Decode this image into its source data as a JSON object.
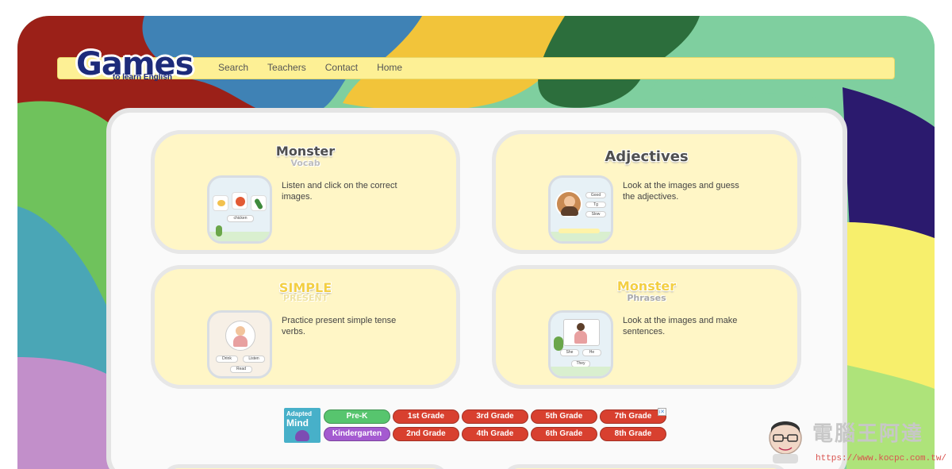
{
  "logo": {
    "main": "Games",
    "sub": "to learn English"
  },
  "nav": {
    "items": [
      "Search",
      "Teachers",
      "Contact",
      "Home"
    ]
  },
  "cards": [
    {
      "title": "Monster",
      "subtitle": "Vocab",
      "description": "Listen and click on the correct images.",
      "thumb_label": "chicken"
    },
    {
      "title": "Adjectives",
      "subtitle": "",
      "description": "Look at the images and guess the adjectives.",
      "thumb_options": [
        "Good",
        "Tg",
        "Slow"
      ]
    },
    {
      "title": "SIMPLE",
      "subtitle": "PRESENT",
      "description": "Practice present simple tense verbs.",
      "thumb_options": [
        "Drink",
        "Listen",
        "Read"
      ]
    },
    {
      "title": "Monster",
      "subtitle": "Phrases",
      "description": "Look at the images and make sentences.",
      "thumb_options": [
        "She",
        "He",
        "They"
      ]
    }
  ],
  "ad": {
    "brand_line1": "Adapted",
    "brand_line2": "Mind",
    "grades_row1": [
      "Pre-K",
      "1st Grade",
      "3rd Grade",
      "5th Grade",
      "7th Grade"
    ],
    "grades_row2": [
      "Kindergarten",
      "2nd Grade",
      "4th Grade",
      "6th Grade",
      "8th Grade"
    ],
    "corner_mark": "i✕",
    "colors": {
      "prek": "#57c56e",
      "kinder": "#a45ad0",
      "grade": "#d8402f"
    }
  },
  "watermark": {
    "title": "電腦王阿達",
    "url": "https://www.kocpc.com.tw/"
  },
  "colors": {
    "navbar": "#fdf095",
    "card": "#fff6c6",
    "panel": "#fafafa",
    "logo": "#1d2b7a"
  }
}
